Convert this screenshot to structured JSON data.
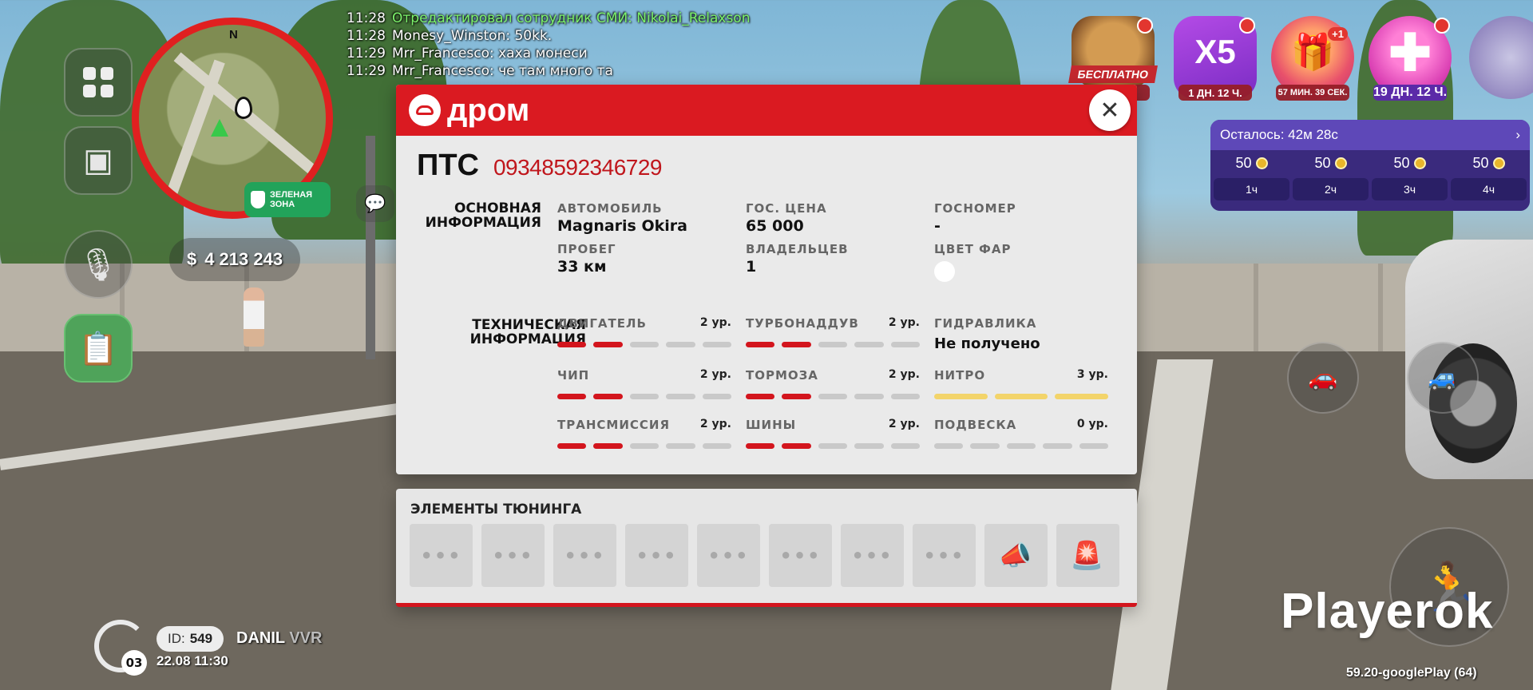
{
  "chat": [
    {
      "time": "11:28",
      "msg": "Отредактировал сотрудник СМИ: Nikolai_Relaxson",
      "green": true
    },
    {
      "time": "11:28",
      "msg": "Monesy_Winston: 50kk.",
      "green": false
    },
    {
      "time": "11:29",
      "msg": "Mrr_Francesco: хаха монеси",
      "green": false
    },
    {
      "time": "11:29",
      "msg": "Mrr_Francesco: че там много та",
      "green": false
    }
  ],
  "map": {
    "north": "N"
  },
  "zone": {
    "line1": "ЗЕЛЕНАЯ",
    "line2": "ЗОНА"
  },
  "money": {
    "symbol": "$",
    "amount": "4 213 243"
  },
  "player": {
    "server": "03",
    "id_label": "ID:",
    "id": "549",
    "name": "DANIL",
    "tag": "VVR",
    "datetime": "22.08 11:30"
  },
  "promos": {
    "chest": {
      "badge": "БЕСПЛАТНО",
      "caption": "ИН."
    },
    "x5": {
      "text": "X5",
      "caption": "1 ДН. 12 Ч."
    },
    "gift": {
      "plus": "+1",
      "caption": "57 МИН. 39 СЕК."
    },
    "pass": {
      "caption": "19 ДН. 12 Ч."
    }
  },
  "timer": {
    "remaining_label": "Осталось:",
    "remaining": "42м 28с",
    "cells": [
      {
        "coins": "50",
        "hour": "1ч"
      },
      {
        "coins": "50",
        "hour": "2ч"
      },
      {
        "coins": "50",
        "hour": "3ч"
      },
      {
        "coins": "50",
        "hour": "4ч"
      }
    ]
  },
  "watermark": "Playerok",
  "version": "59.20-googlePlay (64)",
  "modal": {
    "brand": "дром",
    "pts_title": "ПТС",
    "pts_number": "09348592346729",
    "main_section": "ОСНОВНАЯ ИНФОРМАЦИЯ",
    "tech_section": "ТЕХНИЧЕСКАЯ ИНФОРМАЦИЯ",
    "fields": {
      "car_label": "АВТОМОБИЛЬ",
      "car": "Magnaris Okira",
      "price_label": "ГОС. ЦЕНА",
      "price": "65 000",
      "plate_label": "ГОСНОМЕР",
      "plate": "-",
      "mileage_label": "ПРОБЕГ",
      "mileage": "33 км",
      "owners_label": "ВЛАДЕЛЬЦЕВ",
      "owners": "1",
      "lights_label": "ЦВЕТ ФАР"
    },
    "tech": {
      "engine": {
        "name": "ДВИГАТЕЛЬ",
        "level": "2 ур.",
        "value": 2
      },
      "turbo": {
        "name": "ТУРБОНАДДУВ",
        "level": "2 ур.",
        "value": 2
      },
      "hydraulics": {
        "name": "ГИДРАВЛИКА",
        "status": "Не получено"
      },
      "chip": {
        "name": "ЧИП",
        "level": "2 ур.",
        "value": 2
      },
      "brakes": {
        "name": "ТОРМОЗА",
        "level": "2 ур.",
        "value": 2
      },
      "nitro": {
        "name": "НИТРО",
        "level": "3 ур.",
        "value": 3,
        "max": 3
      },
      "transmission": {
        "name": "ТРАНСМИССИЯ",
        "level": "2 ур.",
        "value": 2
      },
      "tires": {
        "name": "ШИНЫ",
        "level": "2 ур.",
        "value": 2
      },
      "suspension": {
        "name": "ПОДВЕСКА",
        "level": "0 ур.",
        "value": 0
      }
    },
    "max_level": 5
  },
  "tuning": {
    "title": "ЭЛЕМЕНТЫ ТЮНИНГА",
    "slots": [
      "•••",
      "•••",
      "•••",
      "•••",
      "•••",
      "•••",
      "•••",
      "•••"
    ]
  },
  "colors": {
    "accent": "#da1a21",
    "nitro": "#f3d46a",
    "panel": "#eaeaea",
    "timer": "#3a2a7d"
  }
}
